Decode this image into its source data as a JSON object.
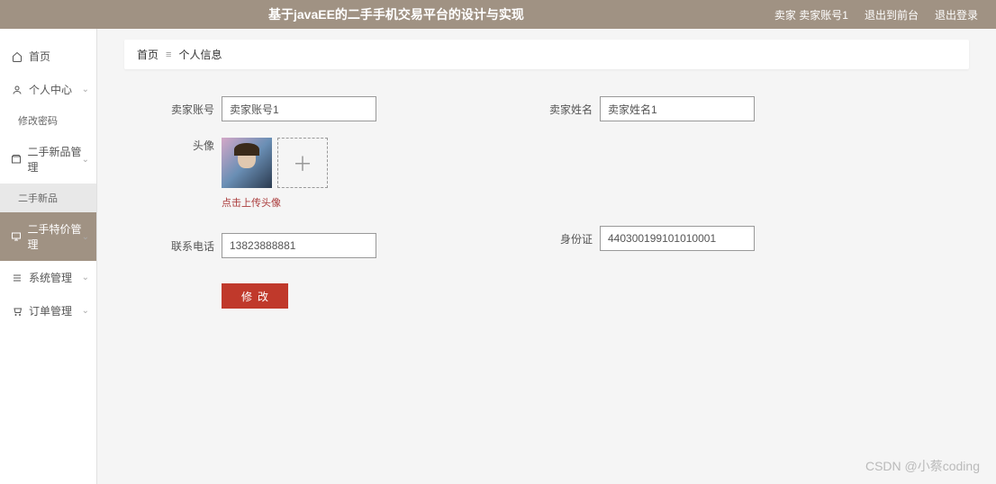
{
  "header": {
    "title": "基于javaEE的二手手机交易平台的设计与实现",
    "user_prefix": "卖家",
    "user_name": "卖家账号1",
    "link_back": "退出到前台",
    "link_logout": "退出登录"
  },
  "sidebar": {
    "items": [
      {
        "label": "首页",
        "icon": "home",
        "expandable": false
      },
      {
        "label": "个人中心",
        "icon": "user",
        "expandable": true
      },
      {
        "label": "修改密码",
        "sub": true,
        "active": false
      },
      {
        "label": "二手新品管理",
        "icon": "box",
        "expandable": true
      },
      {
        "label": "二手新品",
        "sub": true,
        "light": true
      },
      {
        "label": "二手特价管理",
        "icon": "monitor",
        "expandable": true,
        "hovered": true
      },
      {
        "label": "系统管理",
        "icon": "list",
        "expandable": true
      },
      {
        "label": "订单管理",
        "icon": "cart",
        "expandable": true
      }
    ]
  },
  "breadcrumb": {
    "root": "首页",
    "current": "个人信息"
  },
  "form": {
    "account_label": "卖家账号",
    "account_value": "卖家账号1",
    "name_label": "卖家姓名",
    "name_value": "卖家姓名1",
    "avatar_label": "头像",
    "upload_hint": "点击上传头像",
    "id_label": "身份证",
    "id_value": "440300199101010001",
    "phone_label": "联系电话",
    "phone_value": "13823888881",
    "submit_label": "修改"
  },
  "watermark": "CSDN @小蔡coding"
}
